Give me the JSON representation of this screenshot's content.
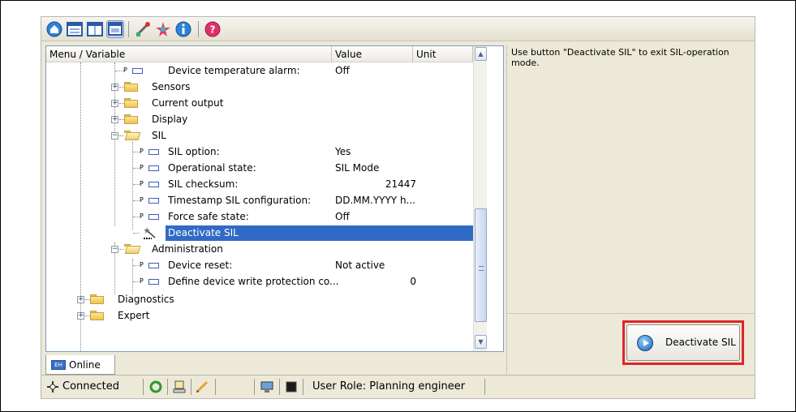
{
  "columns": {
    "menu": "Menu / Variable",
    "value": "Value",
    "unit": "Unit"
  },
  "tree": [
    {
      "label": "Device temperature alarm:",
      "value": "Off"
    },
    {
      "label": "Sensors"
    },
    {
      "label": "Current output"
    },
    {
      "label": "Display"
    },
    {
      "label": "SIL"
    },
    {
      "label": "SIL option:",
      "value": "Yes"
    },
    {
      "label": "Operational state:",
      "value": "SIL Mode"
    },
    {
      "label": "SIL checksum:",
      "value": "21447"
    },
    {
      "label": "Timestamp SIL configuration:",
      "value": "DD.MM.YYYY h..."
    },
    {
      "label": "Force safe state:",
      "value": "Off"
    },
    {
      "label": "Deactivate SIL"
    },
    {
      "label": "Administration"
    },
    {
      "label": "Device reset:",
      "value": "Not active"
    },
    {
      "label": "Define device write protection co...",
      "value": "0"
    },
    {
      "label": "Diagnostics"
    },
    {
      "label": "Expert"
    }
  ],
  "param_prefix": "P",
  "help_text": "Use button \"Deactivate SIL\" to exit SIL-operation mode.",
  "action_button": "Deactivate SIL",
  "tab": {
    "label": "Online",
    "icon_text": "EH"
  },
  "status": {
    "connection": "Connected",
    "user_role": "User Role: Planning engineer"
  },
  "icons": [
    "home-icon",
    "view-icon",
    "view-icon",
    "view-icon",
    "tools-icon",
    "star-icon",
    "info-icon",
    "help-icon"
  ],
  "colors": {
    "selection": "#316ac5",
    "highlight_box": "#e0242b"
  }
}
